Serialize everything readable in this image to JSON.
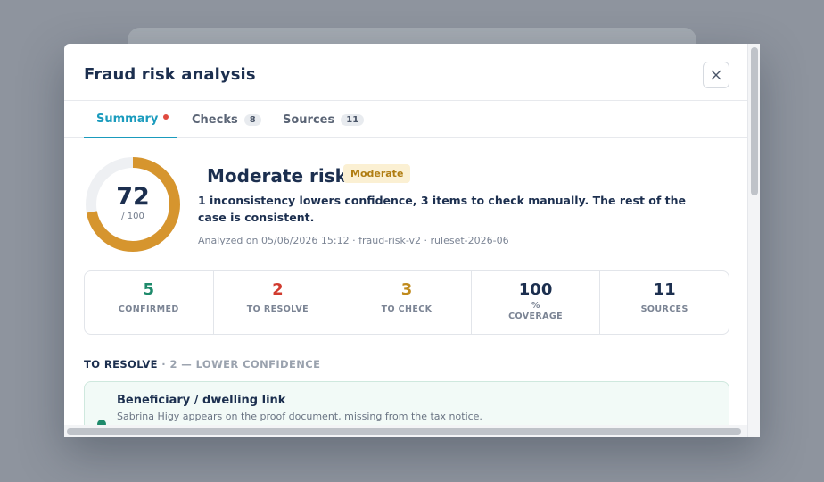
{
  "modal": {
    "title": "Fraud risk analysis",
    "close_icon": "close-icon"
  },
  "tabs": [
    {
      "label": "Summary",
      "active": true,
      "alert_dot": true
    },
    {
      "label": "Checks",
      "count": "8"
    },
    {
      "label": "Sources",
      "count": "11"
    }
  ],
  "score": {
    "value": "72",
    "max": "/ 100",
    "fraction": 0.72,
    "ring_color": "#d6952e",
    "track_color": "#eef0f3"
  },
  "risk": {
    "title": "Moderate risk",
    "badge": "Moderate",
    "description": "1 inconsistency lowers confidence, 3 items to check manually. The rest of the case is consistent.",
    "meta": "Analyzed on 05/06/2026 15:12 · fraud-risk-v2 · ruleset-2026-06"
  },
  "stats": [
    {
      "value": "5",
      "label": "CONFIRMED",
      "color": "#1e8a6b"
    },
    {
      "value": "2",
      "label": "TO RESOLVE",
      "color": "#d13b2f"
    },
    {
      "value": "3",
      "label": "TO CHECK",
      "color": "#c08a1c"
    },
    {
      "value": "100",
      "unit": "%",
      "label": "COVERAGE",
      "color": "#1c2f4f"
    },
    {
      "value": "11",
      "label": "SOURCES",
      "color": "#1c2f4f"
    }
  ],
  "section": {
    "title": "TO RESOLVE",
    "subtitle": " · 2 — LOWER CONFIDENCE"
  },
  "findings": [
    {
      "title": "Beneficiary / dwelling link",
      "description": "Sabrina Higy appears on the proof document, missing from the tax notice.",
      "status_color": "#1e8a6b"
    }
  ]
}
